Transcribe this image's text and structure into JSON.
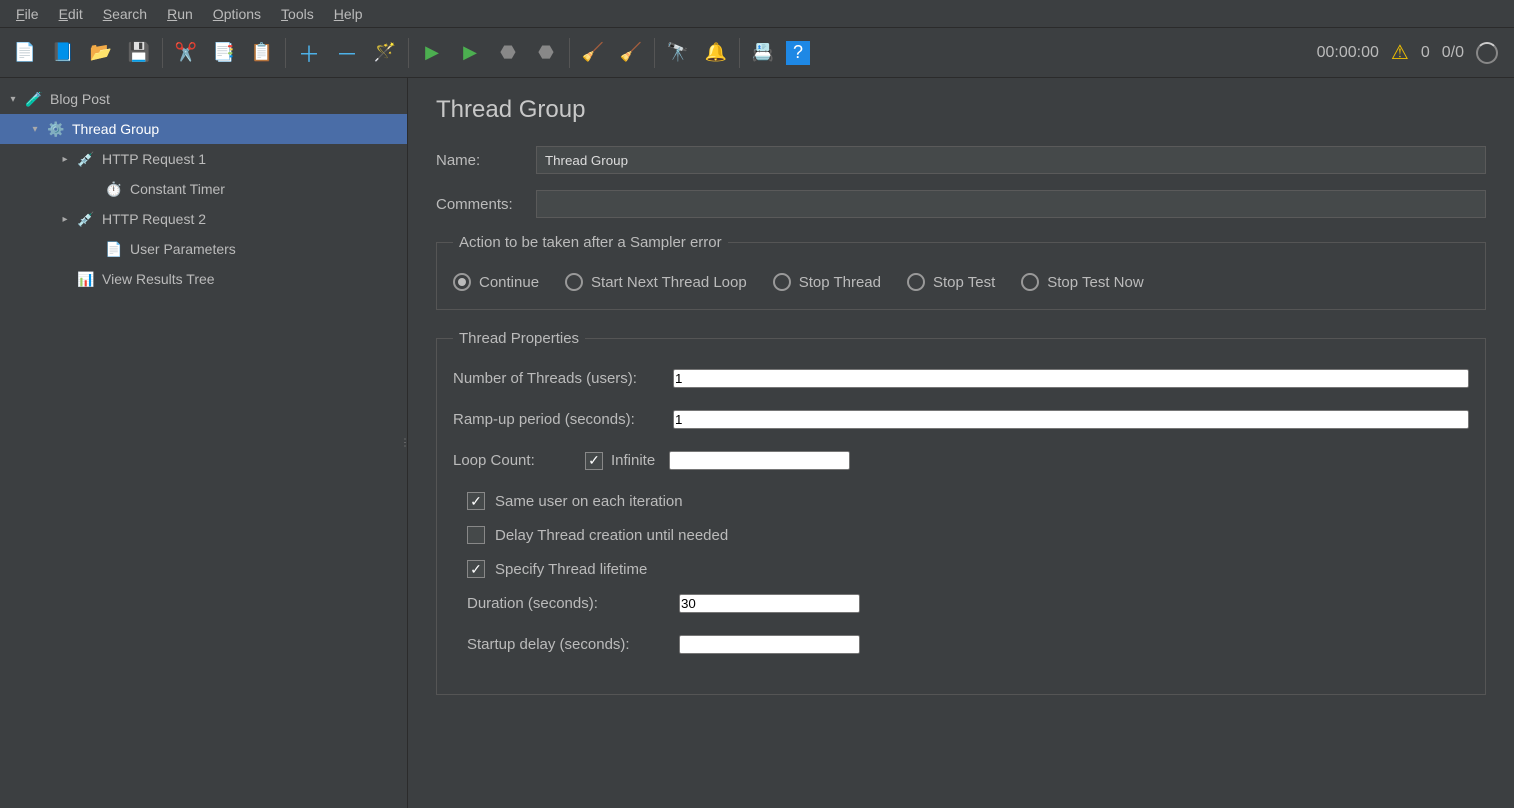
{
  "menubar": [
    "File",
    "Edit",
    "Search",
    "Run",
    "Options",
    "Tools",
    "Help"
  ],
  "toolbar_icons": {
    "new": "new-icon",
    "templates": "templates-icon",
    "open": "open-icon",
    "save": "save-icon",
    "cut": "cut-icon",
    "copy": "copy-icon",
    "paste": "paste-icon",
    "plus": "plus-icon",
    "minus": "minus-icon",
    "wand": "wand-icon",
    "start": "start-icon",
    "start_no_timers": "start-no-timers-icon",
    "stop": "stop-icon",
    "shutdown": "shutdown-icon",
    "clear": "clear-icon",
    "clear_all": "clear-all-icon",
    "search": "search-tool-icon",
    "fn": "function-icon",
    "props": "properties-icon",
    "help": "help-icon"
  },
  "status": {
    "elapsed": "00:00:00",
    "warn_count": "0",
    "threads": "0/0"
  },
  "tree": {
    "root": {
      "label": "Blog Post"
    },
    "thread_group": {
      "label": "Thread Group"
    },
    "http1": {
      "label": "HTTP Request 1"
    },
    "timer": {
      "label": "Constant Timer"
    },
    "http2": {
      "label": "HTTP Request 2"
    },
    "userparams": {
      "label": "User Parameters"
    },
    "results": {
      "label": "View Results Tree"
    }
  },
  "editor": {
    "title": "Thread Group",
    "name_label": "Name:",
    "name_value": "Thread Group",
    "comments_label": "Comments:",
    "comments_value": "",
    "error_action": {
      "legend": "Action to be taken after a Sampler error",
      "options": [
        "Continue",
        "Start Next Thread Loop",
        "Stop Thread",
        "Stop Test",
        "Stop Test Now"
      ],
      "selected": 0
    },
    "thread_props": {
      "legend": "Thread Properties",
      "num_threads_label": "Number of Threads (users):",
      "num_threads_value": "1",
      "ramp_label": "Ramp-up period (seconds):",
      "ramp_value": "1",
      "loop_label": "Loop Count:",
      "infinite_label": "Infinite",
      "infinite_checked": true,
      "loop_value": "",
      "same_user_label": "Same user on each iteration",
      "same_user_checked": true,
      "delay_label": "Delay Thread creation until needed",
      "delay_checked": false,
      "specify_lifetime_label": "Specify Thread lifetime",
      "specify_lifetime_checked": true,
      "duration_label": "Duration (seconds):",
      "duration_value": "30",
      "startup_label": "Startup delay (seconds):",
      "startup_value": ""
    }
  }
}
